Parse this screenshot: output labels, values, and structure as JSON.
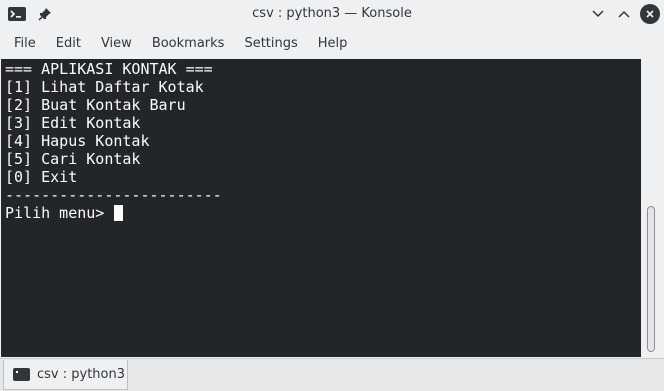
{
  "window": {
    "title": "csv : python3 — Konsole"
  },
  "menu": {
    "items": [
      "File",
      "Edit",
      "View",
      "Bookmarks",
      "Settings",
      "Help"
    ]
  },
  "terminal": {
    "lines": [
      "=== APLIKASI KONTAK ===",
      "[1] Lihat Daftar Kotak",
      "[2] Buat Kontak Baru",
      "[3] Edit Kontak",
      "[4] Hapus Kontak",
      "[5] Cari Kontak",
      "[0] Exit",
      "------------------------",
      "Pilih menu> "
    ]
  },
  "tabs": [
    {
      "label": "csv : python3"
    }
  ],
  "colors": {
    "terminal_bg": "#232629",
    "terminal_fg": "#fcfcfc",
    "chrome_bg": "#eff0f1"
  },
  "icons": {
    "app": "terminal-icon",
    "pin": "pin-icon",
    "minimize": "chevron-down-icon",
    "maximize": "chevron-up-icon",
    "close": "close-icon"
  }
}
